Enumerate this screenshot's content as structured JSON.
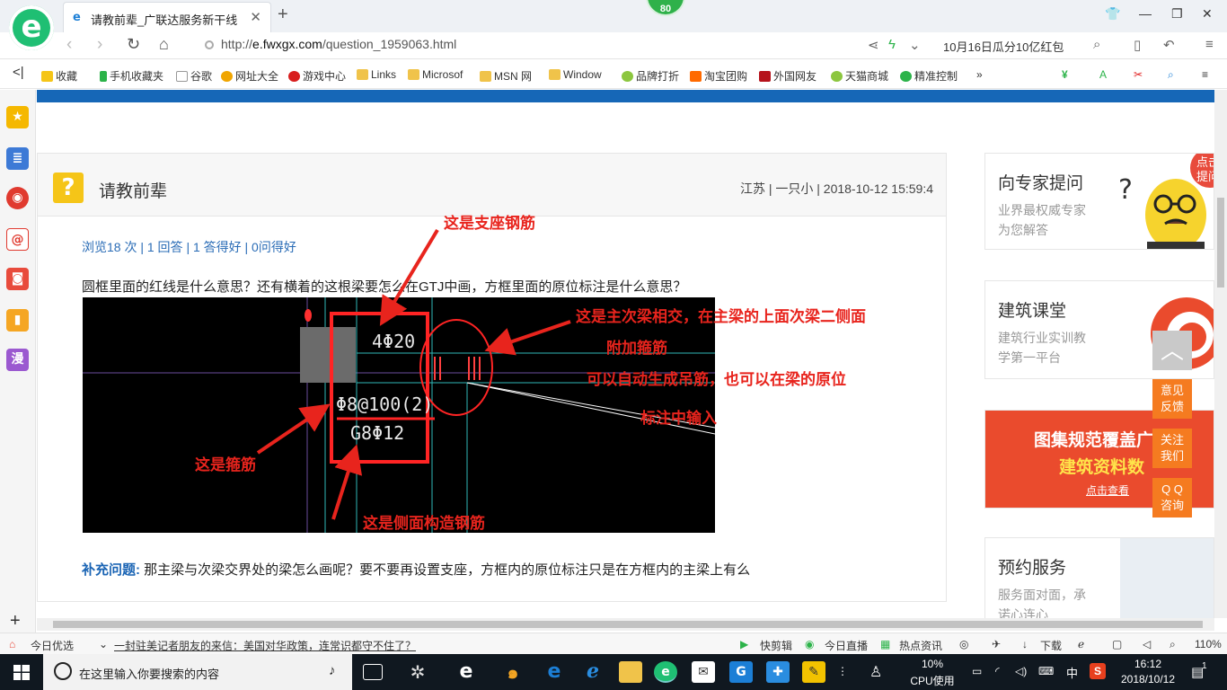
{
  "browser": {
    "tab_title": "请教前辈_广联达服务新干线",
    "score": "80",
    "url_prefix": "http://",
    "url_domain": "e.fwxgx.com",
    "url_path": "/question_1959063.html",
    "news_ticker": "10月16日瓜分10亿红包"
  },
  "bookmarks": [
    "收藏",
    "手机收藏夹",
    "谷歌",
    "网址大全",
    "游戏中心",
    "Links",
    "Microsof",
    "MSN 网",
    "Window",
    "品牌打折",
    "淘宝团购",
    "外国网友",
    "天猫商城",
    "精准控制"
  ],
  "question": {
    "title": "请教前辈",
    "meta": "江苏 | 一只小 | 2018-10-12 15:59:4",
    "stats": "浏览18 次 | 1 回答 | 1 答得好 | 0问得好",
    "text": "圆框里面的红线是什么意思？还有横着的这根梁要怎么在GTJ中画，方框里面的原位标注是什么意思？",
    "supp_label": "补充问题:",
    "supp_text": "那主梁与次梁交界处的梁怎么画呢？要不要再设置支座，方框内的原位标注只是在方框内的主梁上有么"
  },
  "cad_labels": {
    "top": "4Φ20",
    "stirrup": "Φ8@100(2)",
    "side": "G8Φ12"
  },
  "annotations": {
    "support": "这是支座钢筋",
    "intersect_1": "这是主次梁相交，在主梁的上面次梁二侧面",
    "intersect_2": "附加箍筋",
    "intersect_3": "可以自动生成吊筋，也可以在梁的原位",
    "intersect_4": "标注中输入",
    "stirrup": "这是箍筋",
    "side": "这是侧面构造钢筋"
  },
  "sidebar_cards": [
    {
      "title": "向专家提问",
      "sub1": "业界最权威专家",
      "sub2": "为您解答",
      "bubble": "点击\n提问"
    },
    {
      "title": "建筑课堂",
      "sub1": "建筑行业实训教",
      "sub2": "学第一平台"
    },
    {
      "banner1": "图集规范覆盖广",
      "banner2": "建筑资料数",
      "banner3": "点击查看"
    },
    {
      "title": "预约服务",
      "sub1": "服务面对面，承",
      "sub2": "诺心连心"
    }
  ],
  "float_buttons": {
    "feedback": "意见\n反馈",
    "follow": "关注\n我们",
    "qq": "Q Q\n咨询"
  },
  "statusbar": {
    "today": "今日优选",
    "headline": "一封驻美记者朋友的来信：美国对华政策，连常识都守不住了？",
    "clip": "快剪辑",
    "live": "今日直播",
    "hot": "热点资讯",
    "download": "下载",
    "zoom": "110%"
  },
  "taskbar": {
    "search_placeholder": "在这里输入你要搜索的内容",
    "cpu_value": "10%",
    "cpu_label": "CPU使用",
    "ime": "中",
    "time": "16:12",
    "date": "2018/10/12",
    "notify_count": "1"
  },
  "colors": {
    "annotation": "#e8241d",
    "link": "#2a6cb6",
    "brand_green": "#1fbf73",
    "nav_blue": "#1667b7",
    "orange": "#f57b20"
  }
}
